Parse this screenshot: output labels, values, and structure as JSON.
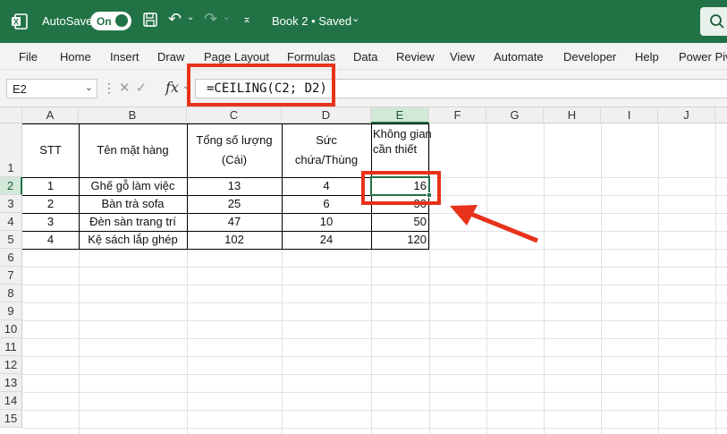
{
  "titlebar": {
    "autosave_label": "AutoSave",
    "autosave_state": "On",
    "title": "Book 2 • Saved",
    "accent_color": "#217346"
  },
  "ribbon": {
    "tabs": [
      "File",
      "Home",
      "Insert",
      "Draw",
      "Page Layout",
      "Formulas",
      "Data",
      "Review",
      "View",
      "Automate",
      "Developer",
      "Help",
      "Power Piv"
    ]
  },
  "formula_bar": {
    "name_box": "E2",
    "formula": "=CEILING(C2; D2)",
    "fx_label": "fx"
  },
  "sheet": {
    "columns": [
      "A",
      "B",
      "C",
      "D",
      "E",
      "F",
      "G",
      "H",
      "I",
      "J"
    ],
    "rows": [
      "1",
      "2",
      "3",
      "4",
      "5",
      "6",
      "7",
      "8",
      "9",
      "10",
      "11",
      "12",
      "13",
      "14",
      "15"
    ],
    "selected_cell": "E2",
    "headers": {
      "a": "STT",
      "b": "Tên mặt hàng",
      "c": "Tổng số lượng (Cái)",
      "d": "Sức chứa/Thùng",
      "e": "Không gian cần thiết"
    },
    "data_rows": [
      {
        "a": "1",
        "b": "Ghế gỗ làm việc",
        "c": "13",
        "d": "4",
        "e": "16"
      },
      {
        "a": "2",
        "b": "Bàn trà sofa",
        "c": "25",
        "d": "6",
        "e": "30"
      },
      {
        "a": "3",
        "b": "Đèn sàn trang trí",
        "c": "47",
        "d": "10",
        "e": "50"
      },
      {
        "a": "4",
        "b": "Kệ sách lắp ghép",
        "c": "102",
        "d": "24",
        "e": "120"
      }
    ]
  },
  "annotation_color": "#e8321a"
}
